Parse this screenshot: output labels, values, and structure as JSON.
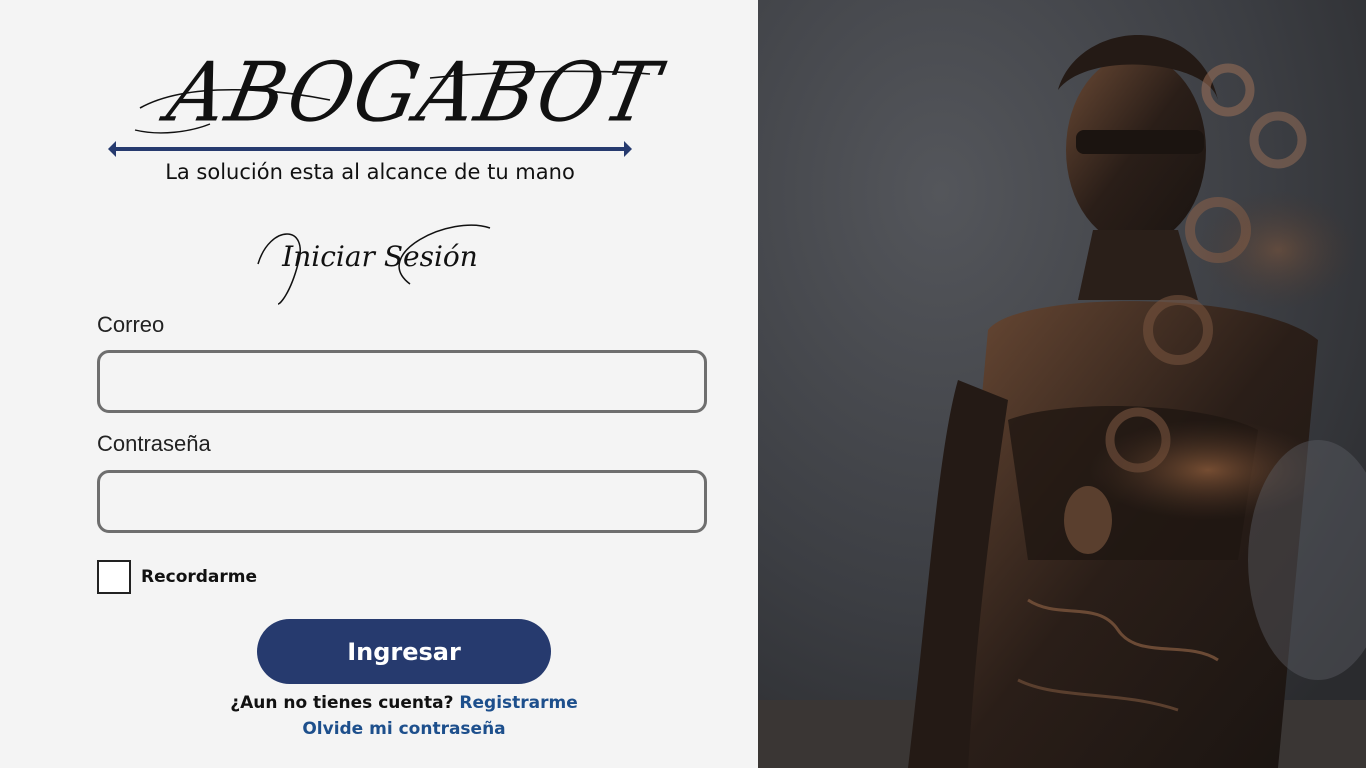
{
  "brand": {
    "name": "ABOGABOT",
    "tagline": "La solución esta al alcance de tu mano",
    "accent": "#263a6e"
  },
  "login": {
    "title": "Iniciar Sesión",
    "email_label": "Correo",
    "email_value": "",
    "password_label": "Contraseña",
    "password_value": "",
    "remember_label": "Recordarme",
    "remember_checked": false,
    "submit_label": "Ingresar",
    "no_account_text": "¿Aun no tienes cuenta?",
    "register_link": "Registrarme",
    "forgot_link": "Olvide mi contraseña"
  },
  "hero_image": {
    "icon": "lady-justice-statue-photo"
  }
}
